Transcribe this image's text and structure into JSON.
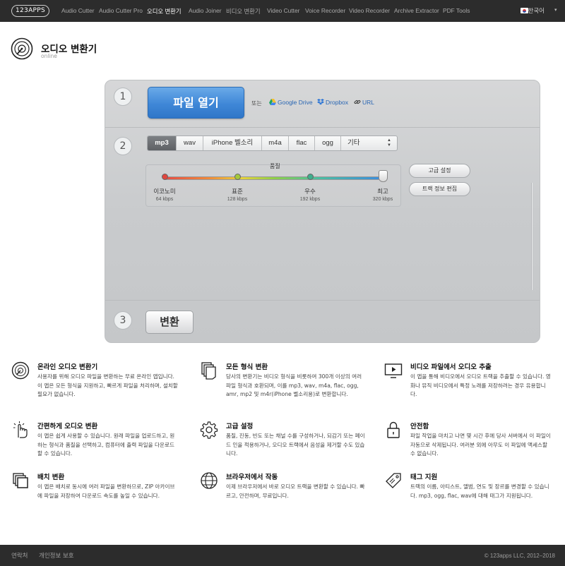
{
  "nav": {
    "logo": "123APPS",
    "links": [
      "Audio Cutter",
      "Audio Cutter Pro",
      "오디오 변환기",
      "Audio Joiner",
      "비디오 변환기",
      "Video Cutter",
      "Voice Recorder",
      "Video Recorder",
      "Archive Extractor",
      "PDF Tools"
    ],
    "active_index": 2,
    "language": "한국어"
  },
  "app": {
    "title": "오디오 변환기",
    "subtitle": "online"
  },
  "converter": {
    "steps": [
      "1",
      "2",
      "3"
    ],
    "open_button": "파일 열기",
    "or": "또는",
    "sources": [
      "Google Drive",
      "Dropbox",
      "URL"
    ],
    "formats": [
      "mp3",
      "wav",
      "iPhone 벨소리",
      "m4a",
      "flac",
      "ogg"
    ],
    "format_other": "기타",
    "selected_format": "mp3",
    "quality": {
      "label": "품질",
      "levels": [
        {
          "name": "이코노미",
          "rate": "64 kbps"
        },
        {
          "name": "표준",
          "rate": "128 kbps"
        },
        {
          "name": "우수",
          "rate": "192 kbps"
        },
        {
          "name": "최고",
          "rate": "320 kbps"
        }
      ],
      "selected_level": 3
    },
    "advanced_button": "고급 설정",
    "track_info_button": "트랙 정보 편집",
    "convert_button": "변환"
  },
  "features": [
    {
      "icon": "vinyl-disc-icon",
      "title": "온라인 오디오 변환기",
      "desc": "사용자를 위해 오디오 파일을 변환하는 무료 온라인 앱입니다. 이 앱은 모든 형식을 지원하고, 빠르게 파일을 처리하며, 설치할 필요가 없습니다."
    },
    {
      "icon": "documents-icon",
      "title": "모든 형식 변환",
      "desc": "당사의 변환기는 비디오 형식을 비롯하여 300개 이상의 여러 파일 형식과 호환되며, 이를 mp3, wav, m4a, flac, ogg, amr, mp2 및 m4r(iPhone 벨소리용)로 변환합니다."
    },
    {
      "icon": "video-screen-icon",
      "title": "비디오 파일에서 오디오 추출",
      "desc": "이 앱을 통해 비디오에서 오디오 트랙을 추출할 수 있습니다. 영화나 뮤직 비디오에서 특정 노래를 저장하려는 경우 유용합니다."
    },
    {
      "icon": "tap-hand-icon",
      "title": "간편하게 오디오 변환",
      "desc": "이 앱은 쉽게 사용할 수 있습니다. 원래 파일을 업로드하고, 원하는 형식과 품질을 선택하고, 컴퓨터에 출력 파일을 다운로드할 수 있습니다."
    },
    {
      "icon": "gear-icon",
      "title": "고급 설정",
      "desc": "품질, 진동, 빈도 또는 채널 수를 구성하거나, 되감기 또는 페이드 인을 적용하거나, 오디오 트랙에서 음성을 제거할 수도 있습니다."
    },
    {
      "icon": "padlock-icon",
      "title": "안전함",
      "desc": "파일 작업을 마치고 나면 몇 시간 후에 당사 서버에서 이 파일이 자동으로 삭제됩니다. 여러분 외에 아무도 이 파일에 액세스할 수 없습니다."
    },
    {
      "icon": "stacked-files-icon",
      "title": "배치 변환",
      "desc": "이 앱은 배치로 동시에 여러 파일을 변환하므로, ZIP 아카이브에 파일을 저장하여 다운로드 속도를 높일 수 있습니다."
    },
    {
      "icon": "globe-icon",
      "title": "브라우저에서 작동",
      "desc": "이제 브라우저에서 바로 오디오 트랙을 변환할 수 있습니다. 빠르고, 안전하며, 무료입니다."
    },
    {
      "icon": "tag-icon",
      "title": "태그 지원",
      "desc": "트랙의 이름, 아티스트, 앨범, 연도 및 장르를 변경할 수 있습니다. mp3, ogg, flac, wav에 대해 태그가 지원됩니다."
    }
  ],
  "footer": {
    "links": [
      "연락처",
      "개인정보 보호"
    ],
    "copyright": "© 123apps LLC, 2012–2018"
  }
}
